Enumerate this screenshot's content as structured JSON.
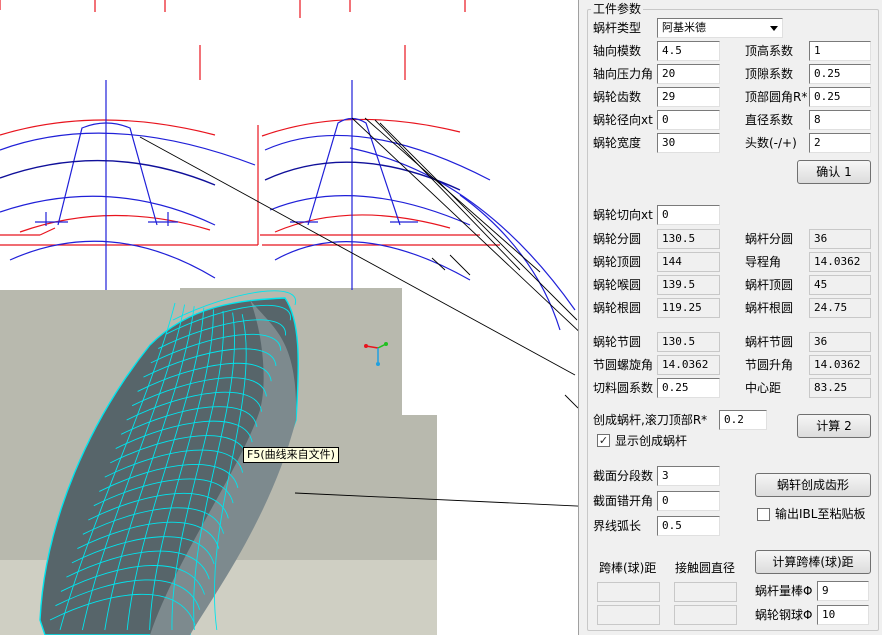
{
  "group_title": "工件参数",
  "worm_type": {
    "label": "蜗杆类型",
    "value": "阿基米德"
  },
  "params_left": [
    {
      "label": "轴向模数",
      "value": "4.5"
    },
    {
      "label": "轴向压力角",
      "value": "20"
    },
    {
      "label": "蜗轮齿数",
      "value": "29"
    },
    {
      "label": "蜗轮径向xt",
      "value": "0"
    },
    {
      "label": "蜗轮宽度",
      "value": "30"
    }
  ],
  "params_right": [
    {
      "label": "顶高系数",
      "value": "1"
    },
    {
      "label": "顶隙系数",
      "value": "0.25"
    },
    {
      "label": "顶部圆角R*",
      "value": "0.25"
    },
    {
      "label": "直径系数",
      "value": "8"
    },
    {
      "label": "头数(-/+)",
      "value": "2"
    }
  ],
  "confirm_button": "确认 1",
  "tangential": {
    "label": "蜗轮切向xt",
    "value": "0"
  },
  "results_left": [
    {
      "label": "蜗轮分圆",
      "value": "130.5"
    },
    {
      "label": "蜗轮顶圆",
      "value": "144"
    },
    {
      "label": "蜗轮喉圆",
      "value": "139.5"
    },
    {
      "label": "蜗轮根圆",
      "value": "119.25"
    }
  ],
  "results_right": [
    {
      "label": "蜗杆分圆",
      "value": "36"
    },
    {
      "label": "导程角",
      "value": "14.0362"
    },
    {
      "label": "蜗杆顶圆",
      "value": "45"
    },
    {
      "label": "蜗杆根圆",
      "value": "24.75"
    }
  ],
  "pitch_left": [
    {
      "label": "蜗轮节圆",
      "value": "130.5"
    },
    {
      "label": "节圆螺旋角",
      "value": "14.0362"
    },
    {
      "label": "切料圆系数",
      "value": "0.25"
    }
  ],
  "pitch_right": [
    {
      "label": "蜗杆节圆",
      "value": "36"
    },
    {
      "label": "节圆升角",
      "value": "14.0362"
    },
    {
      "label": "中心距",
      "value": "83.25"
    }
  ],
  "hob": {
    "label": "创成蜗杆,滚刀顶部R*",
    "value": "0.2"
  },
  "calc_button": "计算 2",
  "show_worm": {
    "label": "显示创成蜗杆",
    "checked": "✓"
  },
  "section_count": {
    "label": "截面分段数",
    "value": "3"
  },
  "section_angle": {
    "label": "截面错开角",
    "value": "0"
  },
  "arc_length": {
    "label": "界线弧长",
    "value": "0.5"
  },
  "gen_tooth_button": "蜗轩创成齿形",
  "export_ibl": {
    "label": "输出IBL至粘贴板"
  },
  "calc_span_button": "计算跨棒(球)距",
  "span_label": "跨棒(球)距",
  "contact_label": "接触圆直径",
  "worm_rod": {
    "label": "蜗杆量棒Φ",
    "value": "9"
  },
  "wheel_ball": {
    "label": "蜗轮钢球Φ",
    "value": "10"
  },
  "tooltip": "F5(曲线来自文件)",
  "colors": {
    "red": "#e8141e",
    "blue": "#2020d8",
    "navy": "#10109a",
    "cyan": "#00e5ee",
    "surface": "#57656a",
    "cad_bg": "#b8b9ae"
  }
}
